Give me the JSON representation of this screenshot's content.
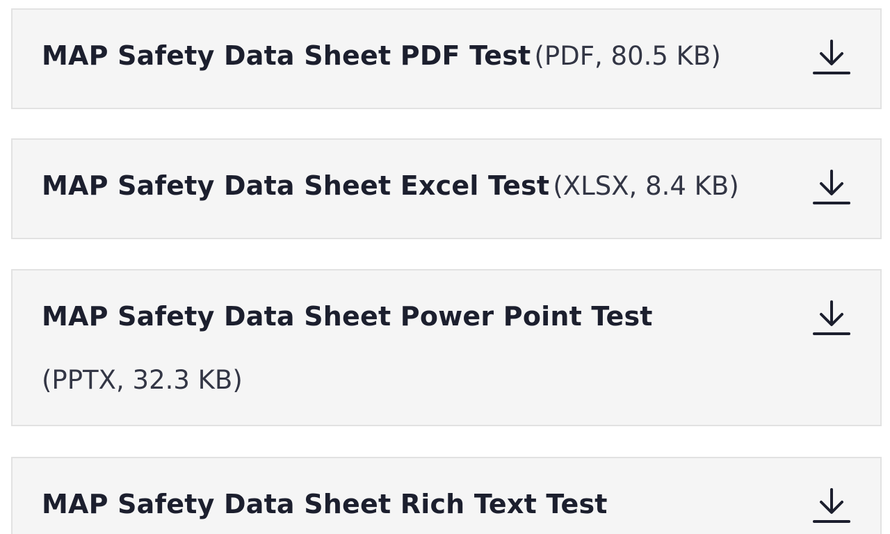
{
  "documents": [
    {
      "title": "MAP Safety Data Sheet PDF Test",
      "meta": "(PDF, 80.5 KB)",
      "icon": "download-icon"
    },
    {
      "title": "MAP Safety Data Sheet Excel Test",
      "meta": "(XLSX, 8.4 KB)",
      "icon": "download-icon"
    },
    {
      "title": "MAP Safety Data Sheet Power Point Test",
      "meta": "(PPTX, 32.3 KB)",
      "icon": "download-icon"
    },
    {
      "title": "MAP Safety Data Sheet Rich Text Test",
      "meta": "",
      "icon": "download-icon"
    }
  ],
  "colors": {
    "card_background": "#f5f5f5",
    "card_border": "#e2e2e2",
    "text": "#1c1f2e"
  }
}
